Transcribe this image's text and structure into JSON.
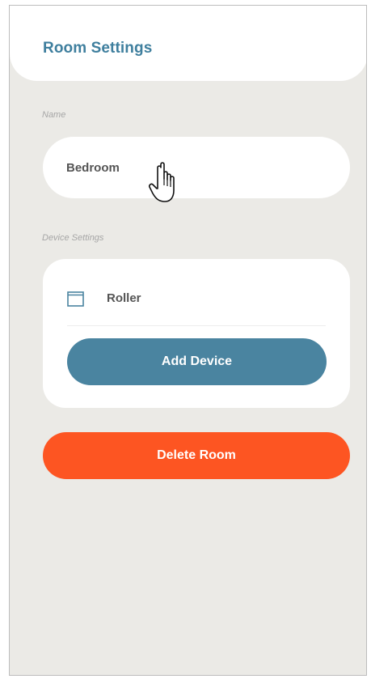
{
  "header": {
    "title": "Room Settings"
  },
  "name_section": {
    "label": "Name",
    "value": "Bedroom"
  },
  "device_section": {
    "label": "Device Settings",
    "devices": [
      {
        "name": "Roller",
        "icon": "roller-blind-icon"
      }
    ],
    "add_label": "Add Device"
  },
  "delete_label": "Delete Room",
  "colors": {
    "accent": "#3f7f9e",
    "primary_button": "#4a84a0",
    "danger_button": "#fd5522",
    "background": "#ebeae6"
  }
}
